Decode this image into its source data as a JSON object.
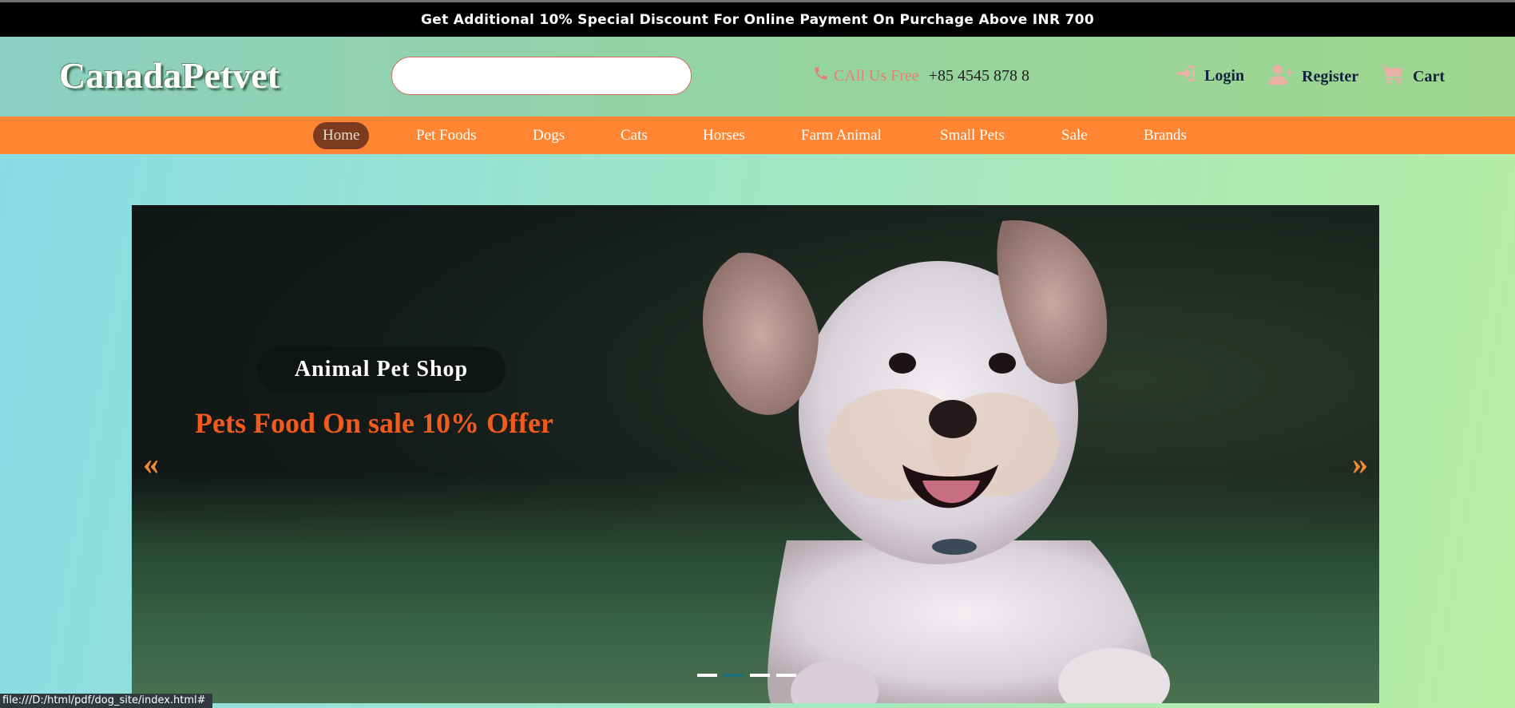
{
  "announcement": "Get Additional 10% Special Discount For Online Payment On Purchage Above INR 700",
  "header": {
    "logo": "CanadaPetvet",
    "search": {
      "value": "",
      "placeholder": ""
    },
    "phone": {
      "label": "CAll Us Free",
      "number": "+85 4545 878 8",
      "icon": "phone-icon"
    },
    "actions": [
      {
        "label": "Login",
        "icon": "login-icon"
      },
      {
        "label": "Register",
        "icon": "add-user-icon"
      },
      {
        "label": "Cart",
        "icon": "cart-icon"
      }
    ]
  },
  "nav": {
    "items": [
      "Home",
      "Pet Foods",
      "Dogs",
      "Cats",
      "Horses",
      "Farm Animal",
      "Small Pets",
      "Sale",
      "Brands"
    ],
    "active": "Home"
  },
  "slider": {
    "caption_title": "Animal Pet Shop",
    "caption_offer": "Pets Food On sale 10% Offer",
    "prev": "«",
    "next": "»",
    "indicator_count": 4,
    "image": "dog-photo"
  },
  "status_bar": "file:///D:/html/pdf/dog_site/index.html#",
  "colors": {
    "nav_bg": "#ff8532",
    "nav_active": "#7a3b1f",
    "offer_text": "#f25a1e",
    "accent_pink": "#e57e7b",
    "dark_text": "#15223d"
  }
}
